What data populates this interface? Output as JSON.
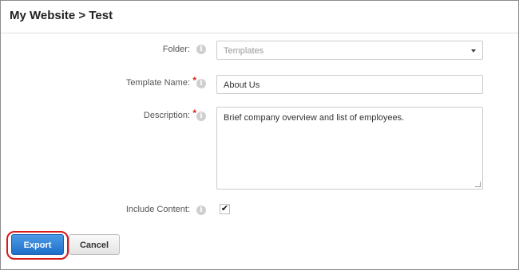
{
  "header": {
    "breadcrumb": "My Website > Test"
  },
  "form": {
    "folder": {
      "label": "Folder:",
      "value": "Templates"
    },
    "template_name": {
      "label": "Template Name:",
      "required_mark": "*",
      "value": "About Us"
    },
    "description": {
      "label": "Description:",
      "required_mark": "*",
      "value": "Brief company overview and list of employees."
    },
    "include_content": {
      "label": "Include Content:",
      "checked": true,
      "check_glyph": "✔"
    },
    "info_glyph": "i"
  },
  "actions": {
    "export_label": "Export",
    "cancel_label": "Cancel"
  },
  "colors": {
    "accent": "#2a7bd6",
    "highlight": "#d7191c",
    "required": "#d9261c"
  }
}
